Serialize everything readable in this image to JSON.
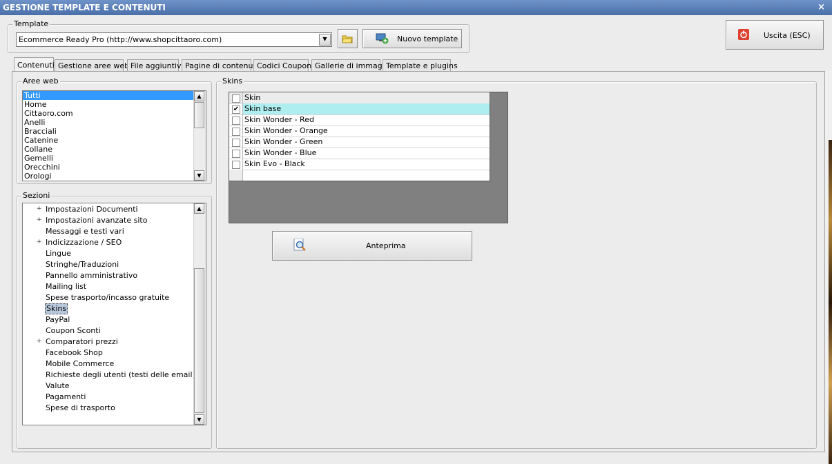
{
  "window": {
    "title": "GESTIONE TEMPLATE E CONTENUTI",
    "close_glyph": "×"
  },
  "template_group": {
    "legend": "Template",
    "selected_template": "Ecommerce Ready Pro (http://www.shopcittaoro.com)",
    "new_template_label": "Nuovo template"
  },
  "exit_button": {
    "label": "Uscita (ESC)"
  },
  "tabs": [
    {
      "label": "Contenuti"
    },
    {
      "label": "Gestione aree web"
    },
    {
      "label": "File aggiuntivi"
    },
    {
      "label": "Pagine di contenuti"
    },
    {
      "label": "Codici Coupon"
    },
    {
      "label": "Gallerie di immagini"
    },
    {
      "label": "Template e plugins"
    }
  ],
  "aree_web": {
    "legend": "Aree web",
    "items": [
      "Tutti",
      "Home",
      "Cittaoro.com",
      "Anelli",
      "Bracciali",
      "Catenine",
      "Collane",
      "Gemelli",
      "Orecchini",
      "Orologi"
    ],
    "selected_index": 0
  },
  "sezioni": {
    "legend": "Sezioni",
    "items": [
      {
        "label": "Impostazioni Documenti",
        "expandable": true
      },
      {
        "label": "Impostazioni avanzate sito",
        "expandable": true
      },
      {
        "label": "Messaggi e testi vari",
        "expandable": false
      },
      {
        "label": "Indicizzazione / SEO",
        "expandable": true
      },
      {
        "label": "Lingue",
        "expandable": false
      },
      {
        "label": "Stringhe/Traduzioni",
        "expandable": false
      },
      {
        "label": "Pannello amministrativo",
        "expandable": false
      },
      {
        "label": "Mailing list",
        "expandable": false
      },
      {
        "label": "Spese trasporto/incasso gratuite",
        "expandable": false
      },
      {
        "label": "Skins",
        "expandable": false,
        "selected": true
      },
      {
        "label": "PayPal",
        "expandable": false
      },
      {
        "label": "Coupon Sconti",
        "expandable": false
      },
      {
        "label": "Comparatori prezzi",
        "expandable": true
      },
      {
        "label": "Facebook Shop",
        "expandable": false
      },
      {
        "label": "Mobile Commerce",
        "expandable": false
      },
      {
        "label": "Richieste degli utenti (testi delle email)",
        "expandable": false
      },
      {
        "label": "Valute",
        "expandable": false
      },
      {
        "label": "Pagamenti",
        "expandable": false
      },
      {
        "label": "Spese di trasporto",
        "expandable": false
      }
    ]
  },
  "skins": {
    "legend": "Skins",
    "column_header": "Skin",
    "rows": [
      {
        "label": "Skin base",
        "checked": true,
        "highlighted": true
      },
      {
        "label": "Skin Wonder - Red",
        "checked": false
      },
      {
        "label": "Skin Wonder - Orange",
        "checked": false
      },
      {
        "label": "Skin Wonder - Green",
        "checked": false
      },
      {
        "label": "Skin Wonder - Blue",
        "checked": false
      },
      {
        "label": "Skin Evo - Black",
        "checked": false
      }
    ],
    "preview_label": "Anteprima"
  },
  "colors": {
    "title_bar": "#4a6fa8",
    "selection": "#3399ff",
    "highlight_row": "#aeeef0",
    "grid_background": "#808080"
  }
}
